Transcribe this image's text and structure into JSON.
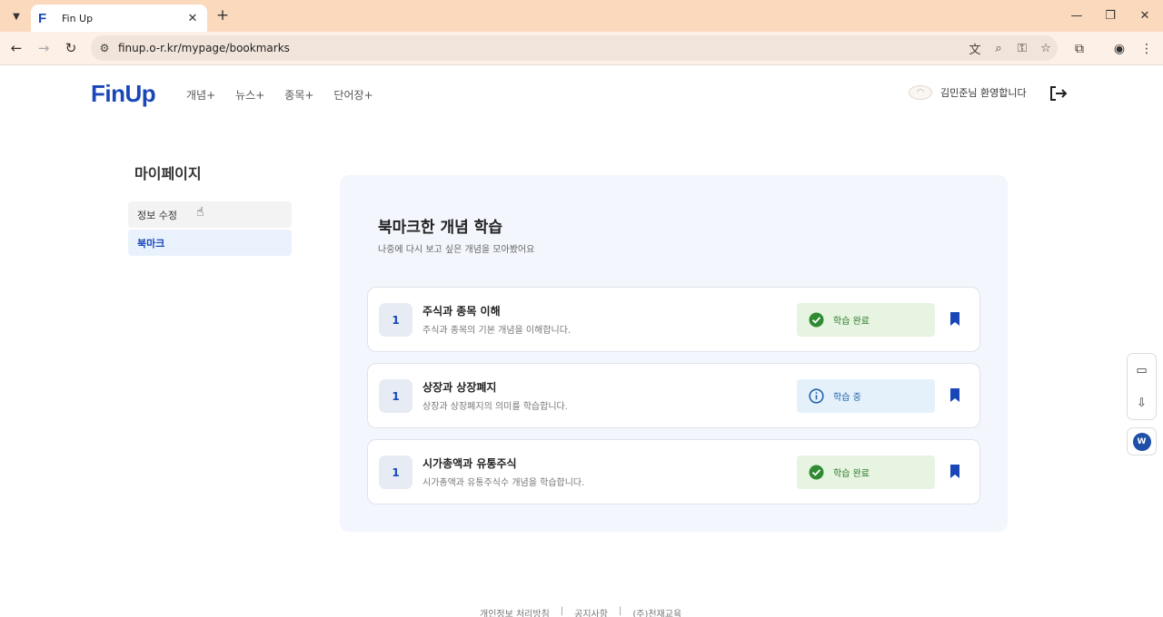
{
  "browser": {
    "tab_title": "Fin Up",
    "tab_favicon": "F",
    "url": "finup.o-r.kr/mypage/bookmarks",
    "colors": {
      "tabbar": "#fbd9bd",
      "toolbar": "#fdf0e6"
    }
  },
  "header": {
    "logo": "FinUp",
    "nav": [
      "개념+",
      "뉴스+",
      "종목+",
      "단어장+"
    ],
    "welcome": "김민준님 환영합니다"
  },
  "sidebar": {
    "title": "마이페이지",
    "items": [
      "정보 수정",
      "북마크"
    ],
    "active_index": 1
  },
  "main": {
    "title": "북마크한 개념 학습",
    "subtitle": "나중에 다시 보고 싶은 개념을 모아봤어요",
    "cards": [
      {
        "num": "1",
        "title": "주식과 종목 이해",
        "desc": "주식과 종목의 기본 개념을 이해합니다.",
        "status": "학습 완료",
        "status_type": "done"
      },
      {
        "num": "1",
        "title": "상장과 상장폐지",
        "desc": "상장과 상장폐지의 의미를 학습합니다.",
        "status": "학습 중",
        "status_type": "progress"
      },
      {
        "num": "1",
        "title": "시가총액과 유통주식",
        "desc": "시가총액과 유통주식수 개념을 학습합니다.",
        "status": "학습 완료",
        "status_type": "done"
      }
    ]
  },
  "footer": {
    "links": [
      "개인정보 처리방침",
      "공지사항",
      "(주)천재교육"
    ],
    "separator": "|"
  },
  "colors": {
    "brand": "#1a47b8",
    "panel_bg": "#f3f6fc",
    "done": "#2c7a2c",
    "progress": "#2561a8"
  }
}
